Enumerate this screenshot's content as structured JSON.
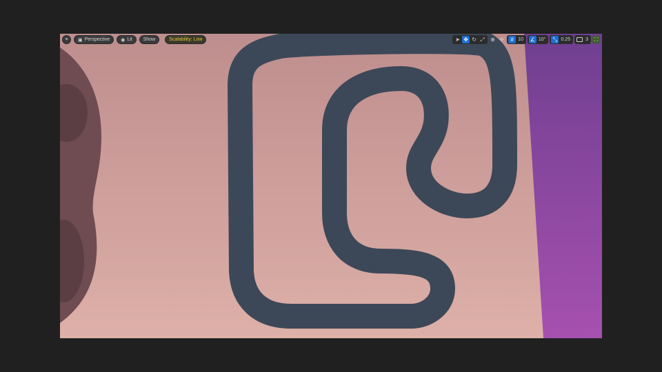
{
  "viewport": {
    "left_toolbar": {
      "perspective_label": "Perspective",
      "lit_label": "Lit",
      "show_label": "Show",
      "scalability_label": "Scalability: Low"
    },
    "right_toolbar": {
      "grid_snap_value": "10",
      "rotation_snap_value": "10°",
      "scale_snap_value": "0.25",
      "camera_speed_value": "3"
    }
  },
  "colors": {
    "ground": "#c89a96",
    "track": "#3d4a5e",
    "purple_wall": "#7a3f98",
    "ui_accent": "#1e6fd0",
    "scalability_text": "#e3c83c"
  },
  "icons": [
    "hamburger-menu-icon",
    "perspective-icon",
    "lit-icon",
    "select-icon",
    "translate-icon",
    "rotate-icon",
    "scale-icon",
    "world-local-icon",
    "surface-snap-icon",
    "grid-snap-icon",
    "rotation-snap-icon",
    "scale-snap-icon",
    "camera-speed-icon",
    "maximize-icon"
  ]
}
